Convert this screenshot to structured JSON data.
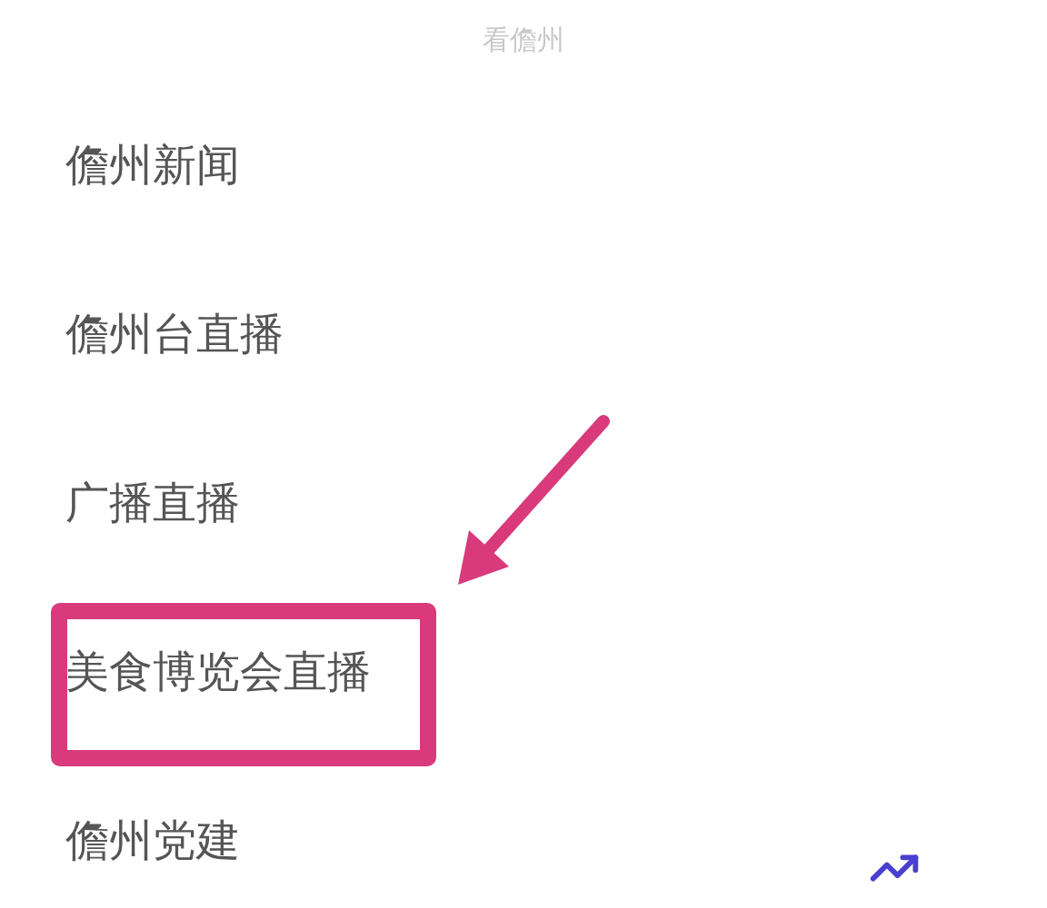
{
  "header": {
    "title": "看儋州"
  },
  "menu": [
    {
      "label": "儋州新闻",
      "highlighted": false
    },
    {
      "label": "儋州台直播",
      "highlighted": false
    },
    {
      "label": "广播直播",
      "highlighted": false
    },
    {
      "label": "美食博览会直播",
      "highlighted": true
    },
    {
      "label": "儋州党建",
      "highlighted": false
    }
  ]
}
